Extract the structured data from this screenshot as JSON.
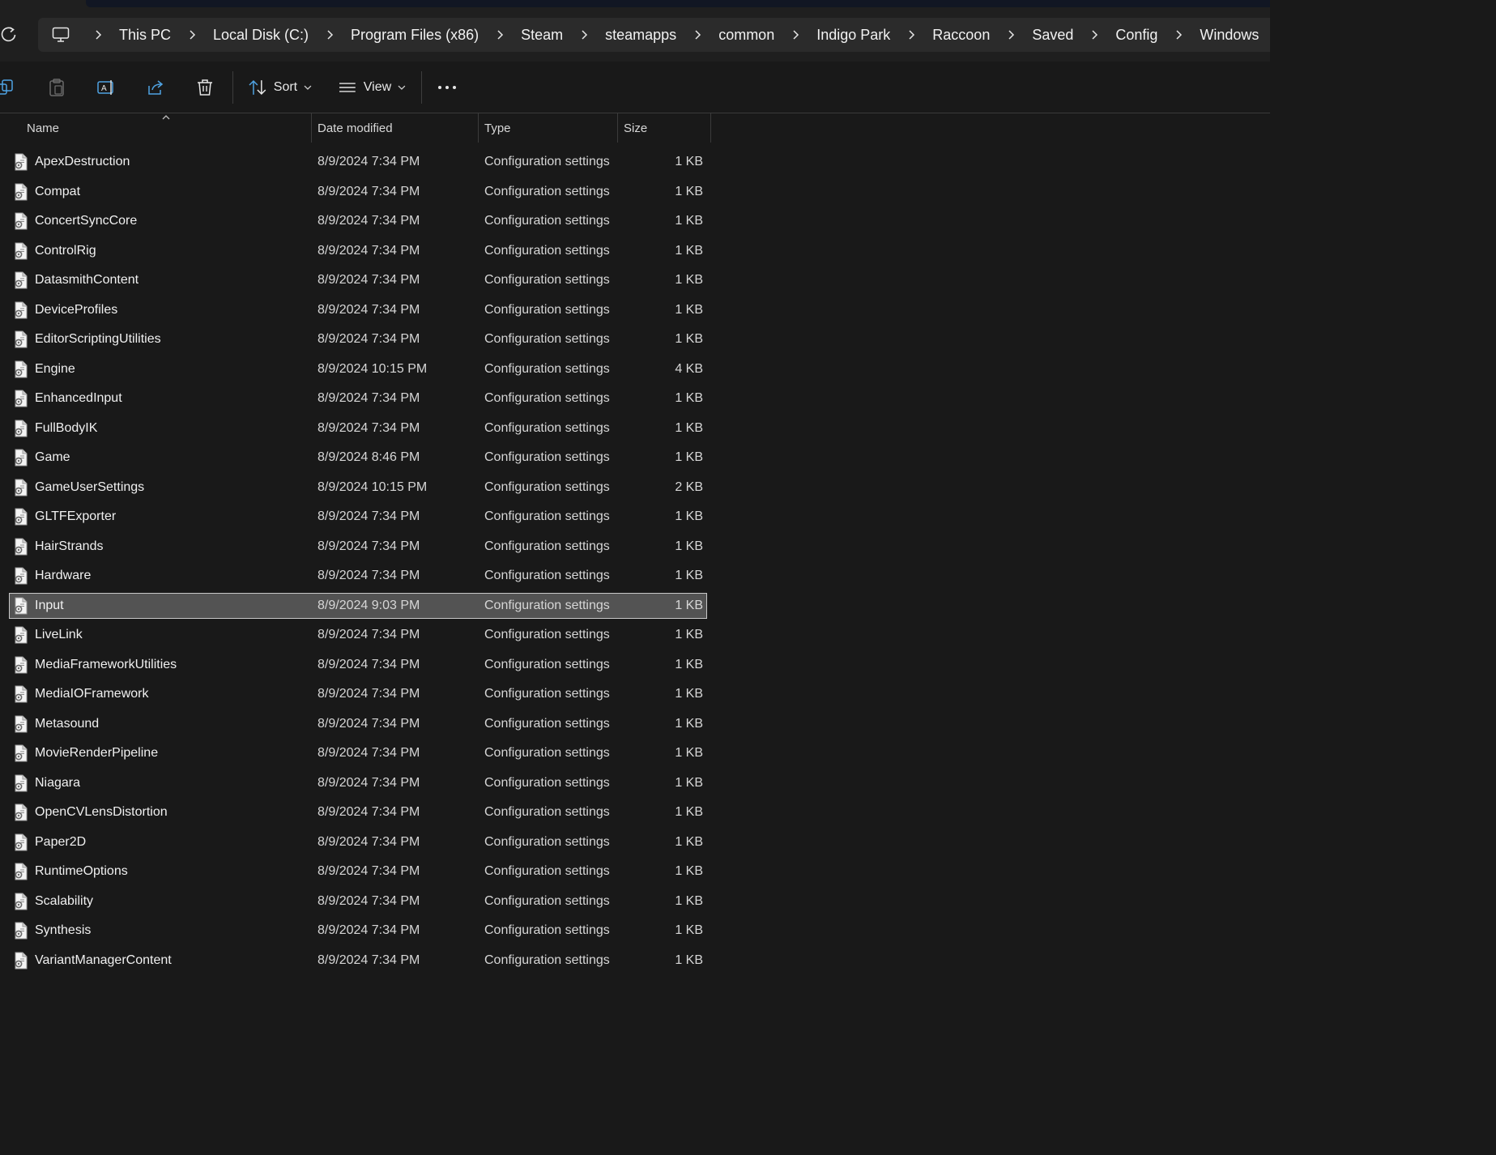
{
  "breadcrumb": [
    "This PC",
    "Local Disk (C:)",
    "Program Files (x86)",
    "Steam",
    "steamapps",
    "common",
    "Indigo Park",
    "Raccoon",
    "Saved",
    "Config",
    "Windows"
  ],
  "toolbar": {
    "sort_label": "Sort",
    "view_label": "View",
    "icons": [
      "copy-icon",
      "paste-icon",
      "rename-icon",
      "share-icon",
      "delete-icon",
      "sort-icon",
      "view-icon",
      "more-icon"
    ]
  },
  "columns": {
    "name": "Name",
    "date": "Date modified",
    "type": "Type",
    "size": "Size"
  },
  "files": [
    {
      "name": "ApexDestruction",
      "date": "8/9/2024 7:34 PM",
      "type": "Configuration settings",
      "size": "1 KB"
    },
    {
      "name": "Compat",
      "date": "8/9/2024 7:34 PM",
      "type": "Configuration settings",
      "size": "1 KB"
    },
    {
      "name": "ConcertSyncCore",
      "date": "8/9/2024 7:34 PM",
      "type": "Configuration settings",
      "size": "1 KB"
    },
    {
      "name": "ControlRig",
      "date": "8/9/2024 7:34 PM",
      "type": "Configuration settings",
      "size": "1 KB"
    },
    {
      "name": "DatasmithContent",
      "date": "8/9/2024 7:34 PM",
      "type": "Configuration settings",
      "size": "1 KB"
    },
    {
      "name": "DeviceProfiles",
      "date": "8/9/2024 7:34 PM",
      "type": "Configuration settings",
      "size": "1 KB"
    },
    {
      "name": "EditorScriptingUtilities",
      "date": "8/9/2024 7:34 PM",
      "type": "Configuration settings",
      "size": "1 KB"
    },
    {
      "name": "Engine",
      "date": "8/9/2024 10:15 PM",
      "type": "Configuration settings",
      "size": "4 KB"
    },
    {
      "name": "EnhancedInput",
      "date": "8/9/2024 7:34 PM",
      "type": "Configuration settings",
      "size": "1 KB"
    },
    {
      "name": "FullBodyIK",
      "date": "8/9/2024 7:34 PM",
      "type": "Configuration settings",
      "size": "1 KB"
    },
    {
      "name": "Game",
      "date": "8/9/2024 8:46 PM",
      "type": "Configuration settings",
      "size": "1 KB"
    },
    {
      "name": "GameUserSettings",
      "date": "8/9/2024 10:15 PM",
      "type": "Configuration settings",
      "size": "2 KB"
    },
    {
      "name": "GLTFExporter",
      "date": "8/9/2024 7:34 PM",
      "type": "Configuration settings",
      "size": "1 KB"
    },
    {
      "name": "HairStrands",
      "date": "8/9/2024 7:34 PM",
      "type": "Configuration settings",
      "size": "1 KB"
    },
    {
      "name": "Hardware",
      "date": "8/9/2024 7:34 PM",
      "type": "Configuration settings",
      "size": "1 KB"
    },
    {
      "name": "Input",
      "date": "8/9/2024 9:03 PM",
      "type": "Configuration settings",
      "size": "1 KB",
      "selected": true
    },
    {
      "name": "LiveLink",
      "date": "8/9/2024 7:34 PM",
      "type": "Configuration settings",
      "size": "1 KB"
    },
    {
      "name": "MediaFrameworkUtilities",
      "date": "8/9/2024 7:34 PM",
      "type": "Configuration settings",
      "size": "1 KB"
    },
    {
      "name": "MediaIOFramework",
      "date": "8/9/2024 7:34 PM",
      "type": "Configuration settings",
      "size": "1 KB"
    },
    {
      "name": "Metasound",
      "date": "8/9/2024 7:34 PM",
      "type": "Configuration settings",
      "size": "1 KB"
    },
    {
      "name": "MovieRenderPipeline",
      "date": "8/9/2024 7:34 PM",
      "type": "Configuration settings",
      "size": "1 KB"
    },
    {
      "name": "Niagara",
      "date": "8/9/2024 7:34 PM",
      "type": "Configuration settings",
      "size": "1 KB"
    },
    {
      "name": "OpenCVLensDistortion",
      "date": "8/9/2024 7:34 PM",
      "type": "Configuration settings",
      "size": "1 KB"
    },
    {
      "name": "Paper2D",
      "date": "8/9/2024 7:34 PM",
      "type": "Configuration settings",
      "size": "1 KB"
    },
    {
      "name": "RuntimeOptions",
      "date": "8/9/2024 7:34 PM",
      "type": "Configuration settings",
      "size": "1 KB"
    },
    {
      "name": "Scalability",
      "date": "8/9/2024 7:34 PM",
      "type": "Configuration settings",
      "size": "1 KB"
    },
    {
      "name": "Synthesis",
      "date": "8/9/2024 7:34 PM",
      "type": "Configuration settings",
      "size": "1 KB"
    },
    {
      "name": "VariantManagerContent",
      "date": "8/9/2024 7:34 PM",
      "type": "Configuration settings",
      "size": "1 KB"
    }
  ],
  "colors": {
    "background": "#191919",
    "chrome": "#1f1f1f",
    "address_bar": "#2b2b2b",
    "selection": "#535353"
  }
}
